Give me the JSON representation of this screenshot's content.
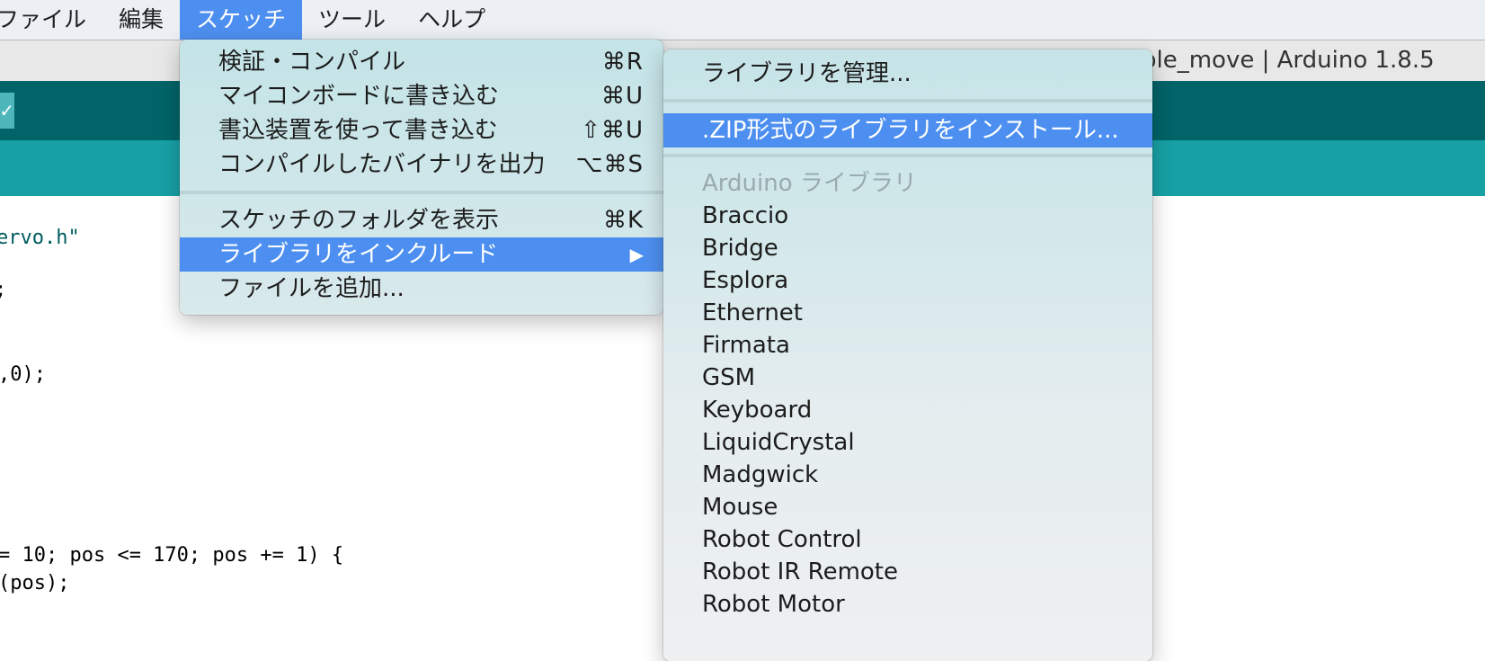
{
  "menubar": {
    "items": [
      {
        "label": "ファイル"
      },
      {
        "label": "編集"
      },
      {
        "label": "スケッチ"
      },
      {
        "label": "ツール"
      },
      {
        "label": "ヘルプ"
      }
    ]
  },
  "window": {
    "title": "ple_move | Arduino 1.8.5"
  },
  "toolbar": {
    "button_label": "✓"
  },
  "code": {
    "lines": [
      "ervo.h\"",
      ";",
      ",0);",
      "= 10; pos <= 170; pos += 1) {",
      "(pos);"
    ]
  },
  "sketch_menu": {
    "items": [
      {
        "label": "検証・コンパイル",
        "shortcut": "⌘R"
      },
      {
        "label": "マイコンボードに書き込む",
        "shortcut": "⌘U"
      },
      {
        "label": "書込装置を使って書き込む",
        "shortcut": "⇧⌘U"
      },
      {
        "label": "コンパイルしたバイナリを出力",
        "shortcut": "⌥⌘S"
      },
      {
        "label": "スケッチのフォルダを表示",
        "shortcut": "⌘K"
      },
      {
        "label": "ライブラリをインクルード",
        "shortcut": "▶"
      },
      {
        "label": "ファイルを追加...",
        "shortcut": ""
      }
    ]
  },
  "library_menu": {
    "manage": "ライブラリを管理...",
    "install_zip": ".ZIP形式のライブラリをインストール...",
    "section_header": "Arduino ライブラリ",
    "libraries": [
      "Braccio",
      "Bridge",
      "Esplora",
      "Ethernet",
      "Firmata",
      "GSM",
      "Keyboard",
      "LiquidCrystal",
      "Madgwick",
      "Mouse",
      "Robot Control",
      "Robot IR Remote",
      "Robot Motor"
    ]
  }
}
